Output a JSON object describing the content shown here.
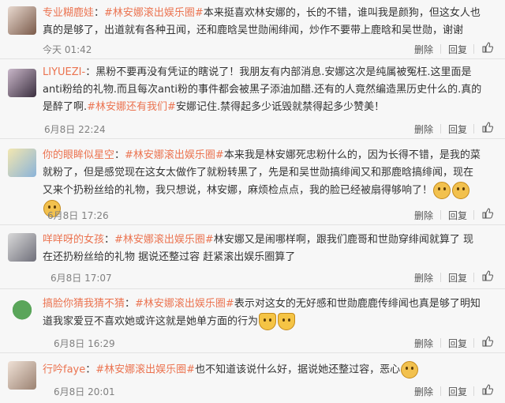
{
  "actions": {
    "delete": "删除",
    "reply": "回复"
  },
  "comments": [
    {
      "user": "专业糊鹿娃",
      "text_before": "：",
      "topic": "#林安娜滚出娱乐圈#",
      "text_after": "本来挺喜欢林安娜的，长的不错，谁叫我是颜狗，但这女人也真的是够了，出道就有各种丑闻，还和鹿晗吴世勋闹绯闻，炒作不要带上鹿晗和吴世勋，谢谢",
      "time": "今天 01:42",
      "emojis": 0
    },
    {
      "user": "LIYUEZI-",
      "text_before": "：黑粉不要再没有凭证的瞎说了！我朋友有内部消息.安娜这次是纯属被冤枉.这里面是anti粉给的礼物.而且每次anti粉的事件都会被黑子添油加醋.还有的人竟然编造黑历史什么的.真的是醉了啊.",
      "topic": "#林安娜还有我们#",
      "text_after": "安娜记住.禁得起多少诋毁就禁得起多少赞美！",
      "time": "6月8日 22:24",
      "emojis": 0
    },
    {
      "user": "你的眼眸似星空",
      "text_before": "：",
      "topic": "#林安娜滚出娱乐圈#",
      "text_after": "本来我是林安娜死忠粉什么的，因为长得不错，是我的菜就粉了，但是感觉现在这女太做作了就粉转黑了，先是和吴世勋搞绯闻又和那鹿晗搞绯闻，现在又来个扔粉丝给的礼物，我只想说，林安娜，麻烦检点点，我的脸已经被扇得够响了！",
      "time": "6月8日 17:26",
      "emojis": 3
    },
    {
      "user": "咩咩呀的女孩",
      "text_before": "：",
      "topic": "#林安娜滚出娱乐圈#",
      "text_after": "林安娜又是闹哪样啊，跟我们鹿哥和世勋穿绯闻就算了 现在还扔粉丝给的礼物 据说还整过容 赶紧滚出娱乐圈算了",
      "time": "6月8日 17:07",
      "emojis": 0
    },
    {
      "user": "搞脸你猜我猜不猜",
      "text_before": "：",
      "topic": "#林安娜滚出娱乐圈#",
      "text_after": "表示对这女的无好感和世勋鹿鹿传绯闻也真是够了明知道我家爱豆不喜欢她或许这就是她单方面的行为",
      "time": "6月8日 16:29",
      "emojis": 2
    },
    {
      "user": "行吟faye",
      "text_before": "：",
      "topic": "#林安娜滚出娱乐圈#",
      "text_after": "也不知道该说什么好，据说她还整过容，恶心",
      "time": "6月8日 20:01",
      "emojis": 1
    }
  ]
}
